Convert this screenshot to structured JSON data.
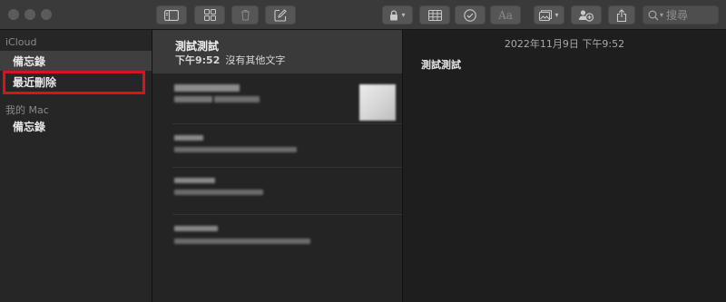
{
  "toolbar": {
    "buttons": [
      {
        "name": "toggle-sidebar-button",
        "icon": "sidebar-icon"
      },
      {
        "name": "gallery-view-button",
        "icon": "grid-icon"
      },
      {
        "name": "delete-button",
        "icon": "trash-icon"
      },
      {
        "name": "new-note-button",
        "icon": "compose-icon"
      },
      {
        "name": "lock-button",
        "icon": "lock-icon"
      },
      {
        "name": "table-button",
        "icon": "table-icon"
      },
      {
        "name": "checklist-button",
        "icon": "checkmark-circle-icon"
      },
      {
        "name": "format-button",
        "icon": "text-format-icon",
        "label": "Aa"
      },
      {
        "name": "media-button",
        "icon": "photo-icon"
      },
      {
        "name": "collaborate-button",
        "icon": "add-people-icon"
      },
      {
        "name": "share-button",
        "icon": "share-icon"
      }
    ],
    "search_placeholder": "搜尋"
  },
  "sidebar": {
    "groups": [
      {
        "title": "iCloud",
        "folders": [
          {
            "label": "備忘錄",
            "selected": true
          },
          {
            "label": "最近刪除",
            "highlighted": true
          }
        ]
      },
      {
        "title": "我的 Mac",
        "folders": [
          {
            "label": "備忘錄"
          }
        ]
      }
    ]
  },
  "notes": {
    "selected": {
      "title": "測試測試",
      "time": "下午9:52",
      "preview": "沒有其他文字"
    }
  },
  "editor": {
    "date": "2022年11月9日 下午9:52",
    "body": "測試測試"
  },
  "colors": {
    "highlight_box": "#d8141b",
    "toolbar_bg": "#3a3a3a",
    "sidebar_bg": "#262626",
    "selected_row_bg": "#3f3f3f"
  }
}
